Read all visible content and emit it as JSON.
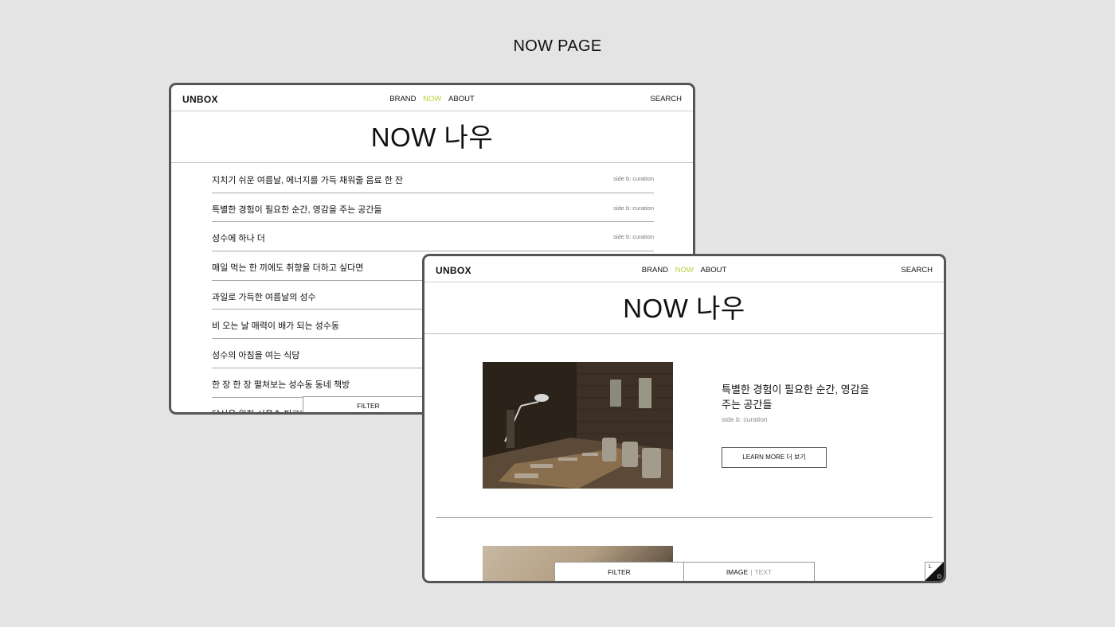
{
  "page_heading": "NOW PAGE",
  "nav": {
    "logo": "UNBOX",
    "menu": [
      "BRAND",
      "NOW",
      "ABOUT"
    ],
    "active": "NOW",
    "search": "SEARCH",
    "active_color": "#b9cf36"
  },
  "hero_title": "NOW 나우",
  "list": {
    "items": [
      {
        "title": "지치기 쉬운 여름날, 에너지를 가득 채워줄 음료 한 잔",
        "tag": "side b: curation"
      },
      {
        "title": "특별한 경험이 필요한 순간, 영감을 주는 공간들",
        "tag": "side b: curation"
      },
      {
        "title": "성수에 하나 더",
        "tag": "side b: curation"
      },
      {
        "title": "매일 먹는 한 끼에도 취향을 더하고 싶다면",
        "tag": ""
      },
      {
        "title": "과일로 가득한 여름날의 성수",
        "tag": ""
      },
      {
        "title": "비 오는 날 매력이 배가 되는 성수동",
        "tag": ""
      },
      {
        "title": "성수의 아침을 여는 식당",
        "tag": ""
      },
      {
        "title": "한 장 한 장 펼쳐보는 성수동 동네 책방",
        "tag": ""
      },
      {
        "title": "당신을 위한 서울숲 피크닉",
        "tag": ""
      }
    ],
    "filter_label": "FILTER"
  },
  "feature": {
    "title": "특별한 경험이 필요한 순간, 영감을 주는 공간들",
    "tag": "side b: curation",
    "button_label": "LEARN MORE 더 보기"
  },
  "bottom_bar": {
    "filter_label": "FILTER",
    "image_label": "IMAGE",
    "separator": "|",
    "text_label": "TEXT"
  },
  "theme_toggle": {
    "light": "L",
    "dark": "D"
  }
}
